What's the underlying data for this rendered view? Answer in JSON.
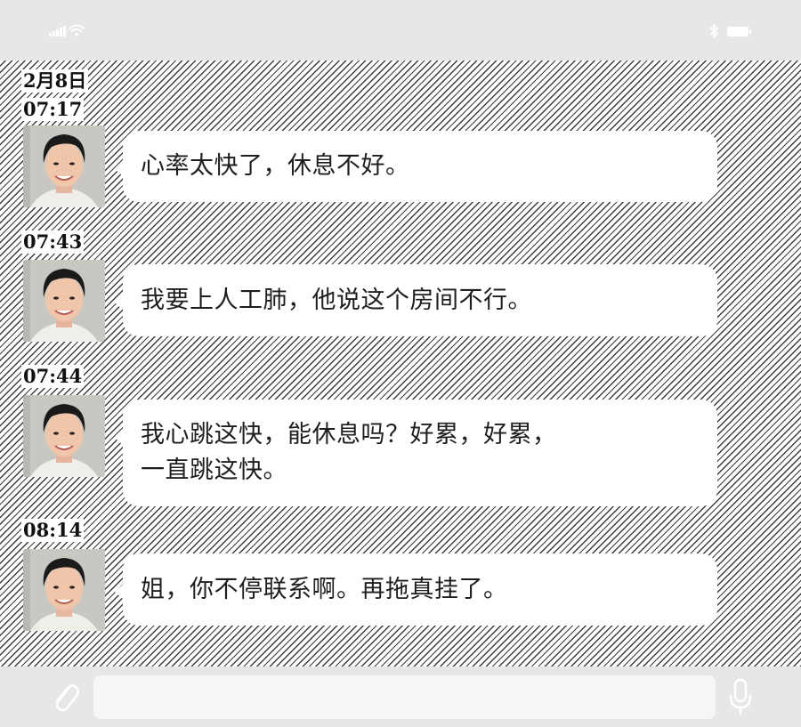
{
  "status_bar": {
    "icons": [
      "signal-icon",
      "wifi-icon",
      "bluetooth-icon",
      "battery-icon"
    ]
  },
  "chat": {
    "date": "2月8日",
    "messages": [
      {
        "time": "07:17",
        "text": "心率太快了，休息不好。"
      },
      {
        "time": "07:43",
        "text": "我要上人工肺，他说这个房间不行。"
      },
      {
        "time": "07:44",
        "text": "我心跳这快，能休息吗？好累，好累，\n一直跳这快。"
      },
      {
        "time": "08:14",
        "text": "姐，你不停联系啊。再拖真挂了。"
      }
    ]
  },
  "input_bar": {
    "placeholder": "",
    "icons": [
      "paperclip-icon",
      "microphone-icon"
    ]
  },
  "colors": {
    "bar_background": "#e7e7e7",
    "bubble": "#ffffff",
    "text": "#1e1e1e",
    "hatch": "#3c3c3c",
    "status_icons": "#ffffff"
  }
}
